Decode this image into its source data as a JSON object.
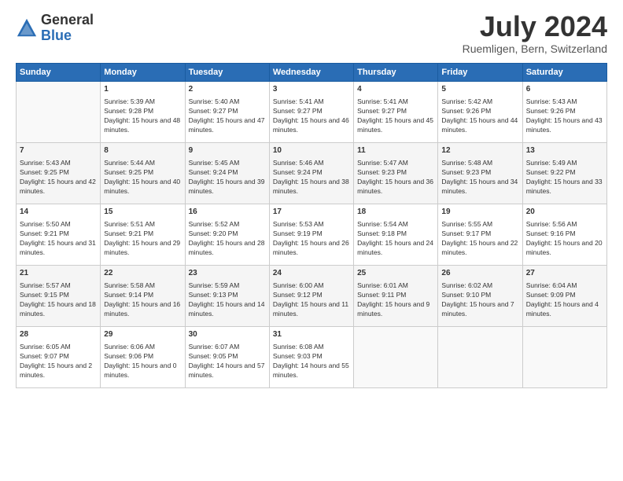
{
  "header": {
    "logo_general": "General",
    "logo_blue": "Blue",
    "title": "July 2024",
    "location": "Ruemligen, Bern, Switzerland"
  },
  "days_of_week": [
    "Sunday",
    "Monday",
    "Tuesday",
    "Wednesday",
    "Thursday",
    "Friday",
    "Saturday"
  ],
  "weeks": [
    [
      {
        "day": "",
        "sunrise": "",
        "sunset": "",
        "daylight": ""
      },
      {
        "day": "1",
        "sunrise": "Sunrise: 5:39 AM",
        "sunset": "Sunset: 9:28 PM",
        "daylight": "Daylight: 15 hours and 48 minutes."
      },
      {
        "day": "2",
        "sunrise": "Sunrise: 5:40 AM",
        "sunset": "Sunset: 9:27 PM",
        "daylight": "Daylight: 15 hours and 47 minutes."
      },
      {
        "day": "3",
        "sunrise": "Sunrise: 5:41 AM",
        "sunset": "Sunset: 9:27 PM",
        "daylight": "Daylight: 15 hours and 46 minutes."
      },
      {
        "day": "4",
        "sunrise": "Sunrise: 5:41 AM",
        "sunset": "Sunset: 9:27 PM",
        "daylight": "Daylight: 15 hours and 45 minutes."
      },
      {
        "day": "5",
        "sunrise": "Sunrise: 5:42 AM",
        "sunset": "Sunset: 9:26 PM",
        "daylight": "Daylight: 15 hours and 44 minutes."
      },
      {
        "day": "6",
        "sunrise": "Sunrise: 5:43 AM",
        "sunset": "Sunset: 9:26 PM",
        "daylight": "Daylight: 15 hours and 43 minutes."
      }
    ],
    [
      {
        "day": "7",
        "sunrise": "Sunrise: 5:43 AM",
        "sunset": "Sunset: 9:25 PM",
        "daylight": "Daylight: 15 hours and 42 minutes."
      },
      {
        "day": "8",
        "sunrise": "Sunrise: 5:44 AM",
        "sunset": "Sunset: 9:25 PM",
        "daylight": "Daylight: 15 hours and 40 minutes."
      },
      {
        "day": "9",
        "sunrise": "Sunrise: 5:45 AM",
        "sunset": "Sunset: 9:24 PM",
        "daylight": "Daylight: 15 hours and 39 minutes."
      },
      {
        "day": "10",
        "sunrise": "Sunrise: 5:46 AM",
        "sunset": "Sunset: 9:24 PM",
        "daylight": "Daylight: 15 hours and 38 minutes."
      },
      {
        "day": "11",
        "sunrise": "Sunrise: 5:47 AM",
        "sunset": "Sunset: 9:23 PM",
        "daylight": "Daylight: 15 hours and 36 minutes."
      },
      {
        "day": "12",
        "sunrise": "Sunrise: 5:48 AM",
        "sunset": "Sunset: 9:23 PM",
        "daylight": "Daylight: 15 hours and 34 minutes."
      },
      {
        "day": "13",
        "sunrise": "Sunrise: 5:49 AM",
        "sunset": "Sunset: 9:22 PM",
        "daylight": "Daylight: 15 hours and 33 minutes."
      }
    ],
    [
      {
        "day": "14",
        "sunrise": "Sunrise: 5:50 AM",
        "sunset": "Sunset: 9:21 PM",
        "daylight": "Daylight: 15 hours and 31 minutes."
      },
      {
        "day": "15",
        "sunrise": "Sunrise: 5:51 AM",
        "sunset": "Sunset: 9:21 PM",
        "daylight": "Daylight: 15 hours and 29 minutes."
      },
      {
        "day": "16",
        "sunrise": "Sunrise: 5:52 AM",
        "sunset": "Sunset: 9:20 PM",
        "daylight": "Daylight: 15 hours and 28 minutes."
      },
      {
        "day": "17",
        "sunrise": "Sunrise: 5:53 AM",
        "sunset": "Sunset: 9:19 PM",
        "daylight": "Daylight: 15 hours and 26 minutes."
      },
      {
        "day": "18",
        "sunrise": "Sunrise: 5:54 AM",
        "sunset": "Sunset: 9:18 PM",
        "daylight": "Daylight: 15 hours and 24 minutes."
      },
      {
        "day": "19",
        "sunrise": "Sunrise: 5:55 AM",
        "sunset": "Sunset: 9:17 PM",
        "daylight": "Daylight: 15 hours and 22 minutes."
      },
      {
        "day": "20",
        "sunrise": "Sunrise: 5:56 AM",
        "sunset": "Sunset: 9:16 PM",
        "daylight": "Daylight: 15 hours and 20 minutes."
      }
    ],
    [
      {
        "day": "21",
        "sunrise": "Sunrise: 5:57 AM",
        "sunset": "Sunset: 9:15 PM",
        "daylight": "Daylight: 15 hours and 18 minutes."
      },
      {
        "day": "22",
        "sunrise": "Sunrise: 5:58 AM",
        "sunset": "Sunset: 9:14 PM",
        "daylight": "Daylight: 15 hours and 16 minutes."
      },
      {
        "day": "23",
        "sunrise": "Sunrise: 5:59 AM",
        "sunset": "Sunset: 9:13 PM",
        "daylight": "Daylight: 15 hours and 14 minutes."
      },
      {
        "day": "24",
        "sunrise": "Sunrise: 6:00 AM",
        "sunset": "Sunset: 9:12 PM",
        "daylight": "Daylight: 15 hours and 11 minutes."
      },
      {
        "day": "25",
        "sunrise": "Sunrise: 6:01 AM",
        "sunset": "Sunset: 9:11 PM",
        "daylight": "Daylight: 15 hours and 9 minutes."
      },
      {
        "day": "26",
        "sunrise": "Sunrise: 6:02 AM",
        "sunset": "Sunset: 9:10 PM",
        "daylight": "Daylight: 15 hours and 7 minutes."
      },
      {
        "day": "27",
        "sunrise": "Sunrise: 6:04 AM",
        "sunset": "Sunset: 9:09 PM",
        "daylight": "Daylight: 15 hours and 4 minutes."
      }
    ],
    [
      {
        "day": "28",
        "sunrise": "Sunrise: 6:05 AM",
        "sunset": "Sunset: 9:07 PM",
        "daylight": "Daylight: 15 hours and 2 minutes."
      },
      {
        "day": "29",
        "sunrise": "Sunrise: 6:06 AM",
        "sunset": "Sunset: 9:06 PM",
        "daylight": "Daylight: 15 hours and 0 minutes."
      },
      {
        "day": "30",
        "sunrise": "Sunrise: 6:07 AM",
        "sunset": "Sunset: 9:05 PM",
        "daylight": "Daylight: 14 hours and 57 minutes."
      },
      {
        "day": "31",
        "sunrise": "Sunrise: 6:08 AM",
        "sunset": "Sunset: 9:03 PM",
        "daylight": "Daylight: 14 hours and 55 minutes."
      },
      {
        "day": "",
        "sunrise": "",
        "sunset": "",
        "daylight": ""
      },
      {
        "day": "",
        "sunrise": "",
        "sunset": "",
        "daylight": ""
      },
      {
        "day": "",
        "sunrise": "",
        "sunset": "",
        "daylight": ""
      }
    ]
  ]
}
